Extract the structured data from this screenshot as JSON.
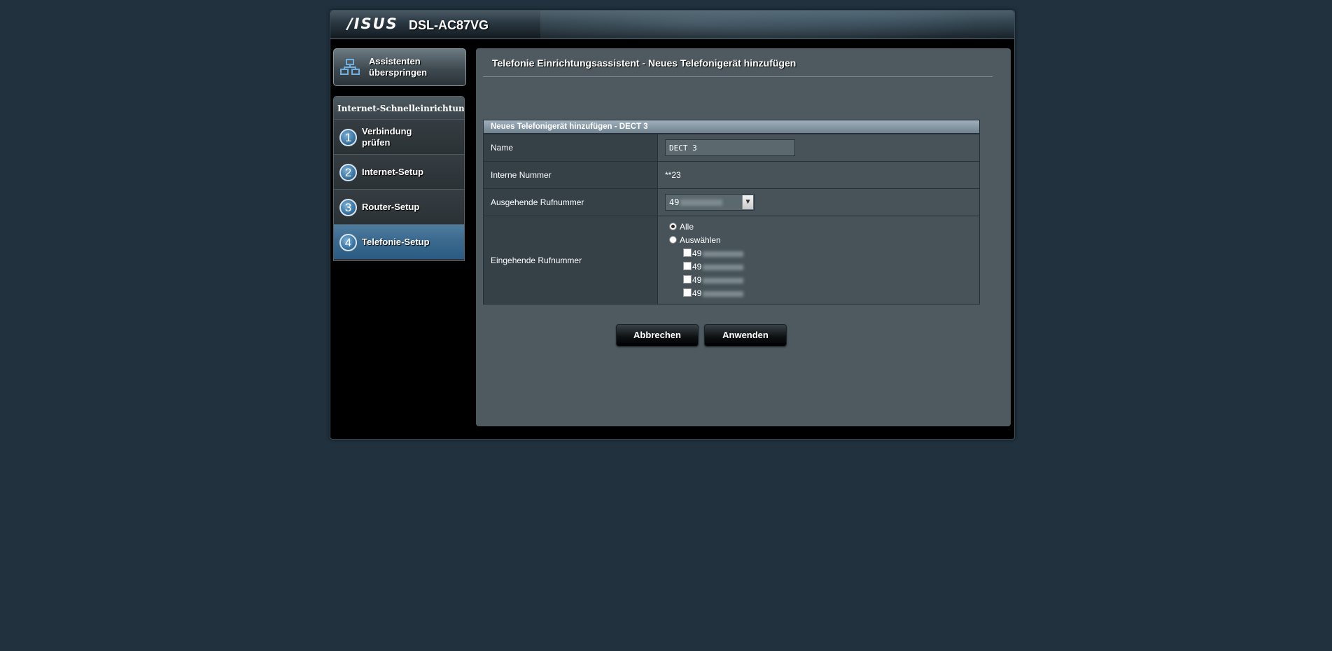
{
  "header": {
    "brand": "/ISUS",
    "model": "DSL-AC87VG"
  },
  "sidebar": {
    "skip_button_label": "Assistenten überspringen",
    "wizard_title": "Internet-Schnelleinrichtung",
    "steps": [
      {
        "num": "1",
        "label": "Verbindung prüfen"
      },
      {
        "num": "2",
        "label": "Internet-Setup"
      },
      {
        "num": "3",
        "label": "Router-Setup"
      },
      {
        "num": "4",
        "label": "Telefonie-Setup"
      }
    ],
    "active_step": 4
  },
  "main": {
    "title": "Telefonie Einrichtungsassistent - Neues Telefonigerät hinzufügen",
    "form_title": "Neues Telefonigerät hinzufügen - DECT 3",
    "fields": {
      "name_label": "Name",
      "name_value": "DECT 3",
      "internal_label": "Interne Nummer",
      "internal_value": "**23",
      "outgoing_label": "Ausgehende Rufnummer",
      "outgoing_value": "49",
      "incoming_label": "Eingehende Rufnummer",
      "incoming_all": "Alle",
      "incoming_select": "Auswählen",
      "incoming_selected": "Alle",
      "numbers": [
        "49",
        "49",
        "49",
        "49"
      ]
    },
    "buttons": {
      "cancel": "Abbrechen",
      "apply": "Anwenden"
    }
  }
}
